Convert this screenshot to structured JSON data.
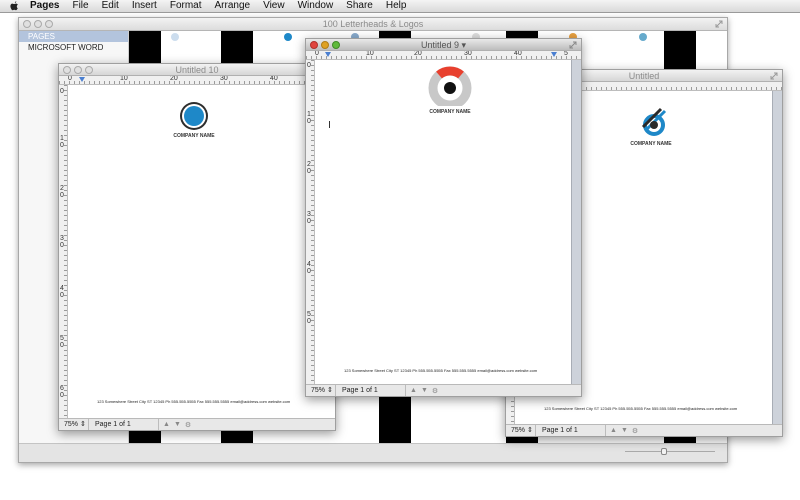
{
  "menubar": {
    "app": "Pages",
    "items": [
      "File",
      "Edit",
      "Insert",
      "Format",
      "Arrange",
      "View",
      "Window",
      "Share",
      "Help"
    ]
  },
  "template_window": {
    "title": "100 Letterheads & Logos",
    "sidebar": [
      "PAGES",
      "MICROSOFT WORD"
    ]
  },
  "windows": {
    "untitled10": {
      "title": "Untitled 10",
      "company": "COMPANY NAME",
      "footer": "123 Somewhere Street City ST 12345    Ph 555.555.5555    Fax 555.555.5555    email@address.com    website.com",
      "zoom": "75%",
      "page": "Page 1 of 1",
      "ruler": [
        "0",
        "10",
        "20",
        "30",
        "40"
      ],
      "vruler": [
        "0",
        "1",
        "0",
        "2",
        "0",
        "3",
        "0",
        "4",
        "0",
        "5",
        "0",
        "6",
        "0"
      ]
    },
    "untitled9": {
      "title": "Untitled 9",
      "company": "COMPANY NAME",
      "footer": "123 Somewhere Street City ST 12345    Ph 555.555.5555    Fax 555.555.5555    email@address.com    website.com",
      "zoom": "75%",
      "page": "Page 1 of 1",
      "ruler": [
        "0",
        "10",
        "20",
        "30",
        "40",
        "5"
      ],
      "vruler": [
        "0",
        "1",
        "0",
        "2",
        "0",
        "3",
        "0",
        "4",
        "0",
        "5",
        "0"
      ]
    },
    "untitled": {
      "title": "Untitled",
      "company": "COMPANY NAME",
      "footer": "123 Somewhere Street City ST 12345    Ph 555.555.5555    Fax 555.555.5555    email@address.com    website.com",
      "zoom": "75%",
      "page": "Page 1 of 1"
    }
  },
  "colors": {
    "logo_blue": "#1e88c8",
    "logo_red": "#e8402e",
    "logo_grey": "#c8c8c8",
    "sidebar_selected": "#b3c4dd"
  }
}
